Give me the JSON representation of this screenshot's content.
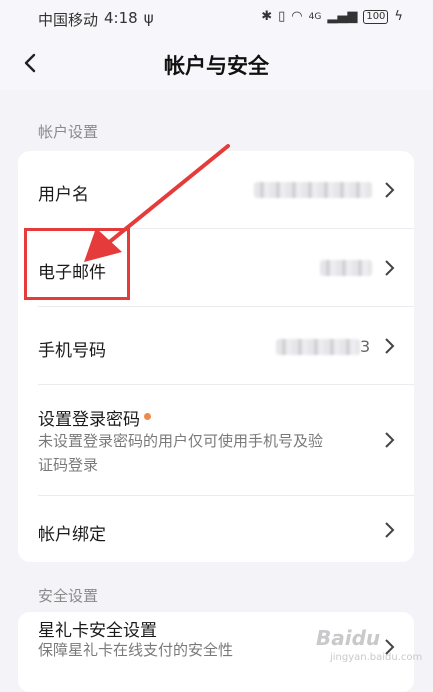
{
  "status_bar": {
    "carrier": "中国移动",
    "time": "4:18",
    "usb_icon": "usb-icon",
    "net_type": "4G",
    "battery": "100"
  },
  "header": {
    "title": "帐户与安全",
    "back_icon": "back-chevron-icon"
  },
  "account_section": {
    "title": "帐户设置",
    "items": [
      {
        "label": "用户名",
        "value_tail": ""
      },
      {
        "label": "电子邮件",
        "value_tail": ""
      },
      {
        "label": "手机号码",
        "value_tail": "3"
      },
      {
        "label": "设置登录密码",
        "desc": "未设置登录密码的用户仅可使用手机号及验证码登录"
      },
      {
        "label": "帐户绑定"
      }
    ]
  },
  "security_section": {
    "title": "安全设置",
    "items": [
      {
        "label": "星礼卡安全设置",
        "desc": "保障星礼卡在线支付的安全性"
      }
    ]
  },
  "annotation": {
    "color": "#e53b3b"
  },
  "watermark": {
    "text": "Baidu",
    "sub": "jingyan.baidu.com"
  }
}
